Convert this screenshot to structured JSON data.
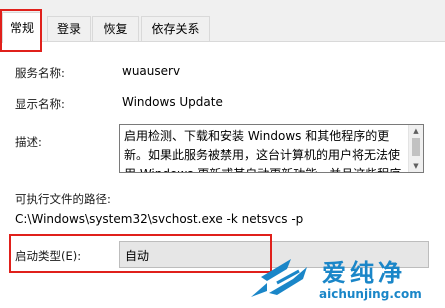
{
  "tabs": [
    {
      "label": "常规",
      "active": true
    },
    {
      "label": "登录",
      "active": false
    },
    {
      "label": "恢复",
      "active": false
    },
    {
      "label": "依存关系",
      "active": false
    }
  ],
  "general": {
    "service_name_label": "服务名称:",
    "service_name": "wuauserv",
    "display_name_label": "显示名称:",
    "display_name": "Windows Update",
    "description_label": "描述:",
    "description": "启用检测、下载和安装 Windows 和其他程序的更新。如果此服务被禁用，这台计算机的用户将无法使用 Windows 更新或其自动更新功能，并且这些程序将",
    "exe_path_label": "可执行文件的路径:",
    "exe_path": "C:\\Windows\\system32\\svchost.exe -k netsvcs -p",
    "startup_type_label": "启动类型(E):",
    "startup_type": "自动"
  },
  "watermark": {
    "brand": "爱纯净",
    "url": "aichunjing.com",
    "color": "#1a86c8"
  },
  "highlight_color": "#e0201b"
}
